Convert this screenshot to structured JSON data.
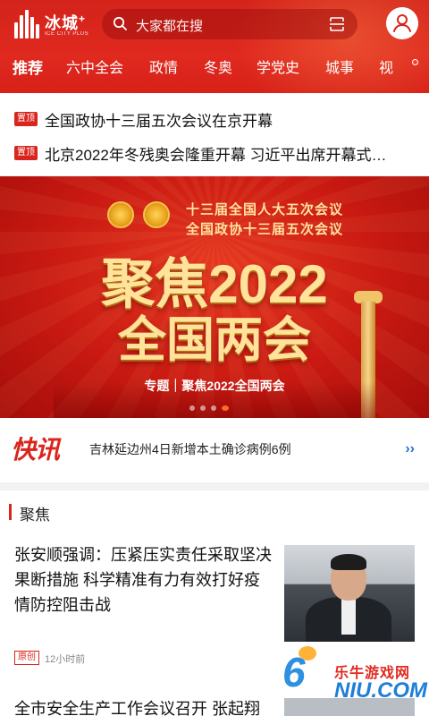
{
  "header": {
    "logo_text": "冰城",
    "logo_plus": "+",
    "logo_sub": "ICE CITY PLUS",
    "search_placeholder": "大家都在搜"
  },
  "tabs": [
    {
      "label": "推荐",
      "active": true
    },
    {
      "label": "六中全会"
    },
    {
      "label": "政情"
    },
    {
      "label": "冬奥"
    },
    {
      "label": "学党史"
    },
    {
      "label": "城事"
    },
    {
      "label": "视"
    }
  ],
  "pinned": {
    "badge": "置顶",
    "items": [
      "全国政协十三届五次会议在京开幕",
      "北京2022年冬残奥会隆重开幕 习近平出席开幕式…"
    ]
  },
  "banner": {
    "sub_lines": [
      "十三届全国人大五次会议",
      "全国政协十三届五次会议"
    ],
    "big_line1": "聚焦2022",
    "big_line2": "全国两会",
    "caption": "专题｜聚焦2022全国两会"
  },
  "flash": {
    "logo": "快讯",
    "text": "吉林延边州4日新增本土确诊病例6例",
    "arrow": "››"
  },
  "focus": {
    "section_title": "聚焦",
    "article1": {
      "title": "张安顺强调：压紧压实责任采取坚决果断措施 科学精准有力有效打好疫情防控阻击战",
      "badge": "原创",
      "time": "12小时前"
    },
    "article2": {
      "title": "全市安全生产工作会议召开 张起翔"
    }
  },
  "watermark": {
    "six": "6",
    "cn": "乐牛游戏网",
    "en": "NIU.COM"
  },
  "colors": {
    "brand_red": "#d9251c",
    "header_red": "#e0291f",
    "link_blue": "#2a6fd6"
  }
}
